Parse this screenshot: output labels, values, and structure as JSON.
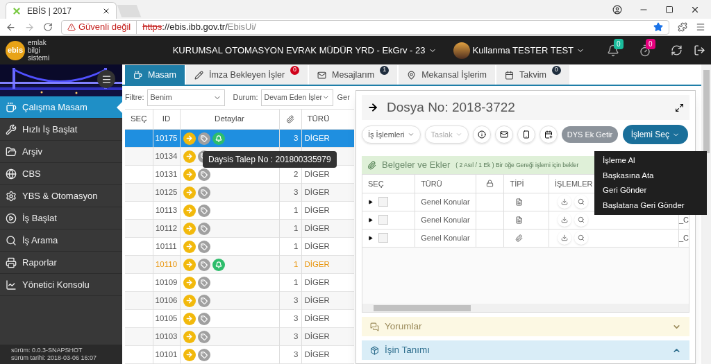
{
  "browser": {
    "tab_title": "EBİS | 2017",
    "security": "Güvenli değil",
    "url_scheme": "https",
    "url_host": "://ebis.ibb.gov.tr/",
    "url_path": "EbisUi/"
  },
  "header": {
    "logo": "ebis",
    "logo_caption": [
      "emlak",
      "bilgi",
      "sistemi"
    ],
    "unit": "KURUMSAL OTOMASYON EVRAK MÜDÜR YRD - EkGrv - 23",
    "user": "Kullanma TESTER TEST",
    "notifications": "0",
    "timers": "0"
  },
  "sidebar": {
    "items": [
      {
        "label": "Çalışma Masam",
        "selected": true
      },
      {
        "label": "Hızlı İş Başlat",
        "selected": false
      },
      {
        "label": "Arşiv",
        "selected": false
      },
      {
        "label": "CBS",
        "selected": false
      },
      {
        "label": "YBS & Otomasyon",
        "selected": false
      },
      {
        "label": "İş Başlat",
        "selected": false
      },
      {
        "label": "İş Arama",
        "selected": false
      },
      {
        "label": "Raporlar",
        "selected": false
      },
      {
        "label": "Yönetici Konsolu",
        "selected": false
      }
    ],
    "version": "sürüm: 0.0.3-SNAPSHOT",
    "build_date": "sürüm tarihi: 2018-03-06 16:07"
  },
  "tabs": [
    {
      "label": "Masam",
      "selected": true
    },
    {
      "label": "İmza Bekleyen İşler",
      "selected": false,
      "badge": "0",
      "color": "#d0021b"
    },
    {
      "label": "Mesajlarım",
      "selected": false,
      "badge": "1",
      "color": "#1f2d3d"
    },
    {
      "label": "Mekansal İşlerim",
      "selected": false
    },
    {
      "label": "Takvim",
      "selected": false,
      "badge": "0",
      "color": "#1f2d3d"
    }
  ],
  "filters": {
    "filter_label": "Filtre:",
    "filter_value": "Benim",
    "status_label": "Durum:",
    "status_value": "Devam Eden İşler",
    "column_3_label": "Ger"
  },
  "table": {
    "columns": [
      "SEÇ",
      "ID",
      "Detaylar",
      "TÜRÜ"
    ],
    "rows": [
      {
        "id": "10175",
        "count": "3",
        "type": "DİGER",
        "bell": true,
        "selected": true,
        "highlighted": false
      },
      {
        "id": "10134",
        "count": "",
        "type": "",
        "bell": false,
        "selected": false,
        "highlighted": false
      },
      {
        "id": "10131",
        "count": "2",
        "type": "DİGER",
        "bell": false,
        "selected": false,
        "highlighted": false
      },
      {
        "id": "10125",
        "count": "3",
        "type": "DİGER",
        "bell": false,
        "selected": false,
        "highlighted": false
      },
      {
        "id": "10113",
        "count": "1",
        "type": "DİGER",
        "bell": false,
        "selected": false,
        "highlighted": false
      },
      {
        "id": "10112",
        "count": "1",
        "type": "DİGER",
        "bell": false,
        "selected": false,
        "highlighted": false
      },
      {
        "id": "10111",
        "count": "1",
        "type": "DİGER",
        "bell": false,
        "selected": false,
        "highlighted": false
      },
      {
        "id": "10110",
        "count": "1",
        "type": "DİGER",
        "bell": true,
        "selected": false,
        "highlighted": true
      },
      {
        "id": "10109",
        "count": "1",
        "type": "DİGER",
        "bell": false,
        "selected": false,
        "highlighted": false
      },
      {
        "id": "10106",
        "count": "3",
        "type": "DİGER",
        "bell": false,
        "selected": false,
        "highlighted": false
      },
      {
        "id": "10105",
        "count": "3",
        "type": "DİGER",
        "bell": false,
        "selected": false,
        "highlighted": false
      },
      {
        "id": "10103",
        "count": "3",
        "type": "DİGER",
        "bell": false,
        "selected": false,
        "highlighted": false
      },
      {
        "id": "10101",
        "count": "3",
        "type": "DİGER",
        "bell": false,
        "selected": false,
        "highlighted": false
      }
    ],
    "tooltip": "Daysis Talep No : 201800335979"
  },
  "dialog": {
    "title": "Dosya No: 2018-3722",
    "toolbar": [
      {
        "label": "İş İşlemleri",
        "disabled": false
      },
      {
        "label": "Taslak",
        "disabled": true
      }
    ],
    "dys_button": "DYS Ek Getir",
    "action_button": "İşlemi Seç",
    "menu": [
      "İşleme Al",
      "Başkasına Ata",
      "Geri Gönder",
      "Başlatana Geri Gönder"
    ],
    "documents": {
      "title": "Belgeler ve Ekler",
      "note": "( 2 Asıl / 1 Ek ) Bir öğe Gereği işlemi için bekler",
      "columns": [
        "SEÇ",
        "TÜRÜ",
        "TİPİ",
        "İŞLEMLER"
      ],
      "rows": [
        {
          "type": "Genel Konular",
          "kind": "document",
          "checked": false
        },
        {
          "type": "Genel Konular",
          "kind": "document",
          "checked": false,
          "column_6": "_C"
        },
        {
          "type": "Genel Konular",
          "kind": "attachment",
          "checked": false,
          "column_6": "_C"
        }
      ]
    },
    "sections": [
      {
        "title": "Yorumlar",
        "expanded": false,
        "kind": "comments"
      },
      {
        "title": "İşin Tanımı",
        "expanded": true,
        "kind": "definition"
      }
    ]
  }
}
